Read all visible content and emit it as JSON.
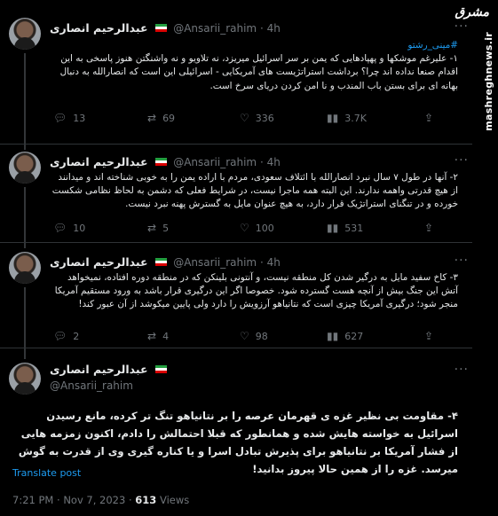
{
  "watermark": {
    "logo": "مشرق",
    "site": "mashreghnews.ir"
  },
  "tweets": [
    {
      "name": "عبدالرحیم انصاری",
      "handle": "@Ansarii_rahim",
      "dot": "·",
      "time": "4h",
      "hashtag": "#مینی_رشتو",
      "text": "۱- علیرغم موشکها و پهپادهایی که یمن بر سر اسرائیل میریزد، نه تلاویو و نه واشنگتن هنوز پاسخی به این اقدام صنعا نداده اند چرا؟ برداشت استراتژیست های آمریکایی - اسرائیلی این است که انصارالله به دنبال بهانه ای برای بستن باب المندب و نا امن کردن دریای سرخ است.",
      "replies": "13",
      "reposts": "69",
      "likes": "336",
      "views": "3.7K"
    },
    {
      "name": "عبدالرحیم انصاری",
      "handle": "@Ansarii_rahim",
      "dot": "·",
      "time": "4h",
      "text": "۲- آنها در طول ۷ سال نبرد انصارالله با ائتلاف سعودی، مردم با اراده یمن را به خوبی شناخته اند و میدانند از هیچ قدرتی واهمه ندارند. این البته همه ماجرا نیست، در شرایط فعلی که دشمن به لحاظ نظامی شکست خورده و در تنگنای استراتژیک قرار دارد، به هیچ عنوان مایل به گسترش پهنه نبرد نیست.",
      "replies": "10",
      "reposts": "5",
      "likes": "100",
      "views": "531"
    },
    {
      "name": "عبدالرحیم انصاری",
      "handle": "@Ansarii_rahim",
      "dot": "·",
      "time": "4h",
      "text": "۳- کاخ سفید مایل به درگیر شدن کل منطقه نیست، و آنتونی بلینکن که در منطقه دوره افتاده، نمیخواهد آتش این جنگ بیش از آنچه هست گسترده شود. خصوصا اگر این درگیری قرار باشد به ورود مستقیم آمریکا منجر شود؛ درگیری آمریکا چیزی است که نتانیاهو آرزویش را دارد ولی پایین میکوشد از آن عبور کند!",
      "replies": "2",
      "reposts": "4",
      "likes": "98",
      "views": "627"
    }
  ],
  "main": {
    "name": "عبدالرحیم انصاری",
    "handle": "@Ansarii_rahim",
    "text": "۴- مقاومت بی نظیر غزه ی قهرمان عرصه را بر نتانیاهو تنگ تر کرده، مانع رسیدن اسرائیل به خواسته هایش شده و همانطور که قبلا احتمالش را دادم، اکنون زمزمه هایی از فشار آمریکا بر نتانیاهو برای پذیرش تبادل اسرا و یا کناره گیری وی از قدرت به گوش میرسد. غزه را از همین حالا پیروز بدانید!",
    "translate": "Translate post",
    "time": "7:21 PM",
    "dot": "·",
    "date": "Nov 7, 2023",
    "views_count": "613",
    "views_label": "Views"
  },
  "icons": {
    "reply": "reply-icon",
    "repost": "repost-icon",
    "like": "heart-icon",
    "views": "views-icon",
    "bookmark": "bookmark-icon",
    "share": "share-icon",
    "more": "more-icon"
  },
  "colors": {
    "accent": "#1d9bf0",
    "muted": "#71767b",
    "bg": "#000000",
    "text": "#e7e9ea"
  }
}
